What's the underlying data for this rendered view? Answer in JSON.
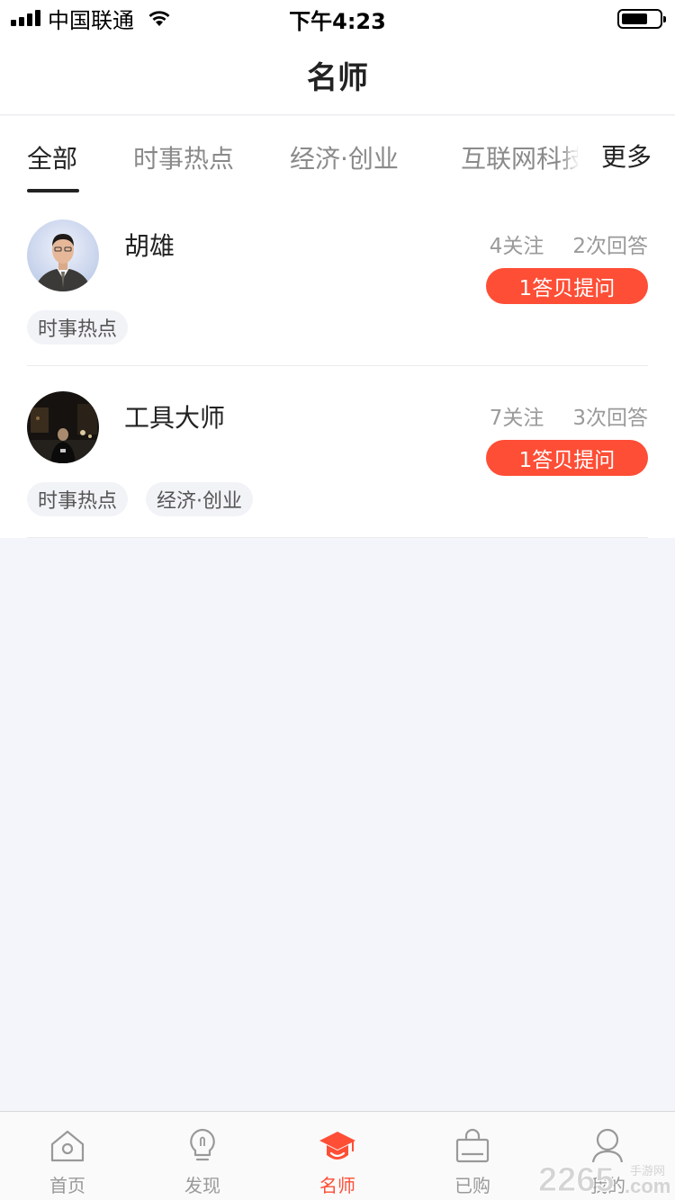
{
  "status_bar": {
    "carrier": "中国联通",
    "time": "下午4:23"
  },
  "nav": {
    "title": "名师"
  },
  "tabs": [
    {
      "label": "全部",
      "active": true
    },
    {
      "label": "时事热点",
      "active": false
    },
    {
      "label": "经济·创业",
      "active": false
    },
    {
      "label": "互联网科技",
      "active": false
    }
  ],
  "tabs_more": "更多",
  "teachers": [
    {
      "name": "胡雄",
      "followers": "4关注",
      "answers": "2次回答",
      "ask_button": "1答贝提问",
      "tags": [
        "时事热点"
      ]
    },
    {
      "name": "工具大师",
      "followers": "7关注",
      "answers": "3次回答",
      "ask_button": "1答贝提问",
      "tags": [
        "时事热点",
        "经济·创业"
      ]
    }
  ],
  "tabbar": [
    {
      "label": "首页",
      "icon": "home-icon",
      "active": false
    },
    {
      "label": "发现",
      "icon": "lightbulb-icon",
      "active": false
    },
    {
      "label": "名师",
      "icon": "graduation-cap-icon",
      "active": true
    },
    {
      "label": "已购",
      "icon": "shopping-bag-icon",
      "active": false
    },
    {
      "label": "我的",
      "icon": "user-icon",
      "active": false
    }
  ],
  "watermark": {
    "text": "2265",
    "suffix": "手游网",
    "domain": ".com"
  },
  "colors": {
    "accent": "#fe4e36",
    "background": "#f4f5fa",
    "tag_bg": "#f2f3f7"
  }
}
